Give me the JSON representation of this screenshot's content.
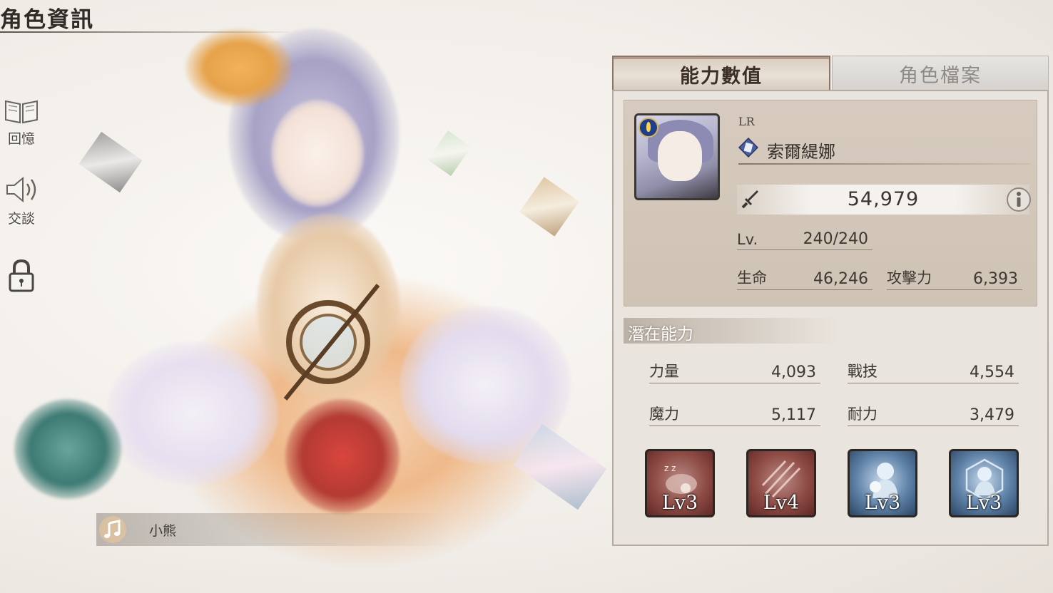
{
  "header": {
    "title": "角色資訊"
  },
  "side_menu": [
    {
      "label": "回憶",
      "icon": "book-icon"
    },
    {
      "label": "交談",
      "icon": "speaker-icon"
    },
    {
      "label": "",
      "icon": "lock-icon"
    }
  ],
  "voice": {
    "label": "小熊",
    "icon": "music-note-icon"
  },
  "tabs": {
    "active": "能力數值",
    "inactive": "角色檔案"
  },
  "character": {
    "rarity": "LR",
    "name": "索爾緹娜",
    "power": "54,979",
    "level_label": "Lv.",
    "level": "240/240",
    "hp_label": "生命",
    "hp": "46,246",
    "atk_label": "攻擊力",
    "atk": "6,393"
  },
  "potential": {
    "title": "潛在能力",
    "str_label": "力量",
    "str": "4,093",
    "tech_label": "戰技",
    "tech": "4,554",
    "mag_label": "魔力",
    "mag": "5,117",
    "end_label": "耐力",
    "end": "3,479"
  },
  "skills": [
    {
      "level": "Lv3",
      "color": "red"
    },
    {
      "level": "Lv4",
      "color": "red"
    },
    {
      "level": "Lv3",
      "color": "blue"
    },
    {
      "level": "Lv3",
      "color": "blue"
    }
  ]
}
